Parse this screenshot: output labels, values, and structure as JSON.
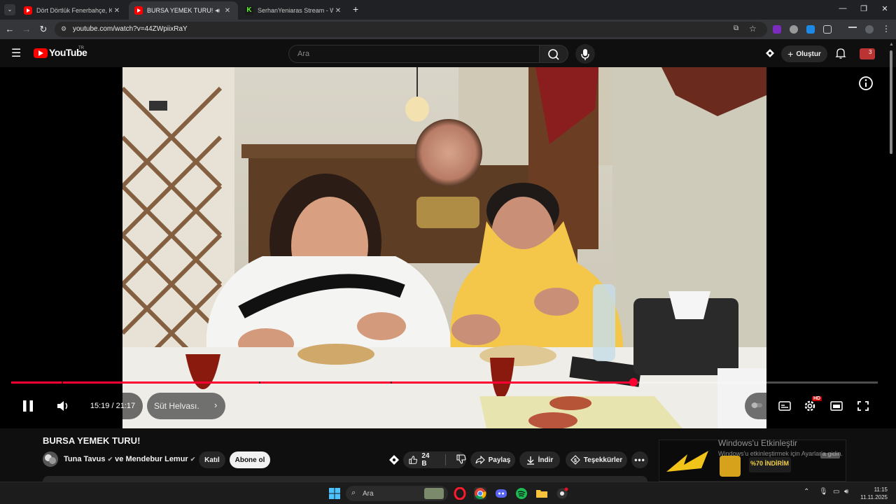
{
  "browser": {
    "tabs": [
      {
        "title": "Dört Dörtlük Fenerbahçe, Kocae",
        "favicon": "youtube-icon",
        "active": false
      },
      {
        "title": "BURSA YEMEK TURU! - You",
        "favicon": "youtube-icon",
        "active": true
      },
      {
        "title": "SerhanYeniaras Stream - Watch",
        "favicon": "kick-icon",
        "active": false
      }
    ],
    "new_tab": "+",
    "url": "youtube.com/watch?v=44ZWpiixRaY"
  },
  "youtube": {
    "logo": "YouTube",
    "region": "TR",
    "search_placeholder": "Ara",
    "create_label": "Oluştur",
    "notification_badge": "3"
  },
  "player": {
    "time": "15:19 / 21:17",
    "chapter": "Süt Helvası.",
    "progress_fraction": 0.718,
    "chapter_marks": [
      0.058,
      0.286,
      0.438
    ],
    "quality_badge": "HD"
  },
  "video": {
    "title": "BURSA YEMEK TURU!",
    "channel": "Tuna Tavus",
    "channel_join": "ve",
    "collaborator": "Mendebur Lemur",
    "join_label": "Katıl",
    "subscribe_label": "Abone ol",
    "likes": "24 B",
    "share_label": "Paylaş",
    "download_label": "İndir",
    "thanks_label": "Teşekkürler"
  },
  "ad": {
    "badge": "%70 İNDİRİM"
  },
  "windows": {
    "activate_title": "Windows'u Etkinleştir",
    "activate_sub": "Windows'u etkinleştirmek için Ayarlar'a gidin.",
    "search_placeholder": "Ara",
    "time": "11:15",
    "date": "11.11.2025"
  },
  "colors": {
    "accent": "#ff0033",
    "youtube_red": "#ff0000",
    "background": "#0f0f0f"
  }
}
